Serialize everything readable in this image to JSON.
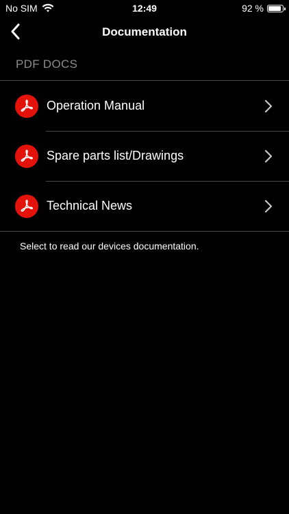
{
  "status_bar": {
    "carrier": "No SIM",
    "time": "12:49",
    "battery_percent": "92 %",
    "battery_level": 0.92
  },
  "nav": {
    "title": "Documentation",
    "back_icon": "chevron-left-icon"
  },
  "section": {
    "header": "PDF DOCS"
  },
  "documents": [
    {
      "label": "Operation Manual",
      "icon": "pdf-icon"
    },
    {
      "label": "Spare parts list/Drawings",
      "icon": "pdf-icon"
    },
    {
      "label": "Technical News",
      "icon": "pdf-icon"
    }
  ],
  "footer": {
    "text": "Select to read our devices documentation."
  },
  "colors": {
    "background": "#000000",
    "pdf_red": "#e3120b",
    "separator": "#4a4a4a",
    "section_header": "#8c8c8c"
  }
}
